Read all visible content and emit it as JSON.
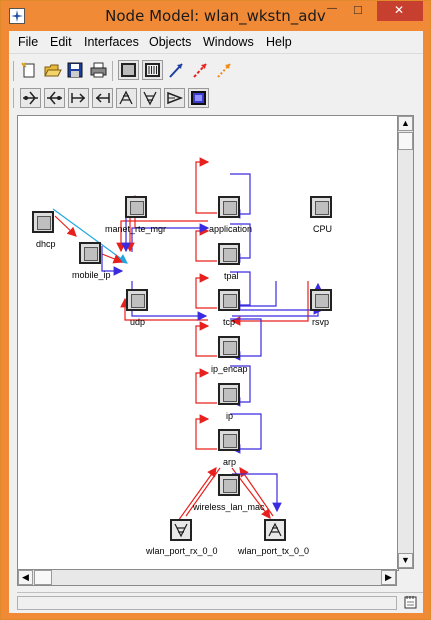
{
  "window": {
    "title": "Node Model: wlan_wkstn_adv",
    "minimize_glyph": "—",
    "maximize_glyph": "□",
    "close_glyph": "✕"
  },
  "menu": {
    "items": [
      "File",
      "Edit",
      "Interfaces",
      "Objects",
      "Windows",
      "Help"
    ]
  },
  "toolbar1": {
    "icons": [
      "new-document-icon",
      "open-folder-icon",
      "save-icon",
      "print-icon",
      "create-processor-icon",
      "create-queue-icon",
      "create-packet-stream-icon",
      "create-statistic-wire-icon",
      "create-logical-association-icon"
    ]
  },
  "toolbar2": {
    "icons": [
      "create-point-to-point-transmitter-icon",
      "create-point-to-point-receiver-icon",
      "create-bus-transmitter-icon",
      "create-bus-receiver-icon",
      "create-radio-transmitter-icon",
      "create-radio-receiver-icon",
      "create-antenna-icon",
      "create-external-system-icon"
    ]
  },
  "nodes": [
    {
      "id": "dhcp",
      "label": "dhcp"
    },
    {
      "id": "mobile_ip",
      "label": "mobile_ip"
    },
    {
      "id": "manet_rte_mgr",
      "label": "manet_rte_mgr"
    },
    {
      "id": "udp",
      "label": "udp"
    },
    {
      "id": "application",
      "label": "application"
    },
    {
      "id": "tpal",
      "label": "tpal"
    },
    {
      "id": "tcp",
      "label": "tcp"
    },
    {
      "id": "ip_encap",
      "label": "ip_encap"
    },
    {
      "id": "ip",
      "label": "ip"
    },
    {
      "id": "arp",
      "label": "arp"
    },
    {
      "id": "wireless_lan_mac",
      "label": "wireless_lan_mac"
    },
    {
      "id": "CPU",
      "label": "CPU"
    },
    {
      "id": "rsvp",
      "label": "rsvp"
    },
    {
      "id": "wlan_port_rx_0_0",
      "label": "wlan_port_rx_0_0"
    },
    {
      "id": "wlan_port_tx_0_0",
      "label": "wlan_port_tx_0_0"
    }
  ],
  "colors": {
    "titlebar": "#f08a37",
    "close_button": "#c7402f",
    "stream_red": "#e8201d",
    "stream_blue": "#3a2be0",
    "statwire_cyan": "#22a8e0"
  },
  "scroll": {
    "up_glyph": "▲",
    "down_glyph": "▼",
    "left_glyph": "◀",
    "right_glyph": "▶"
  }
}
